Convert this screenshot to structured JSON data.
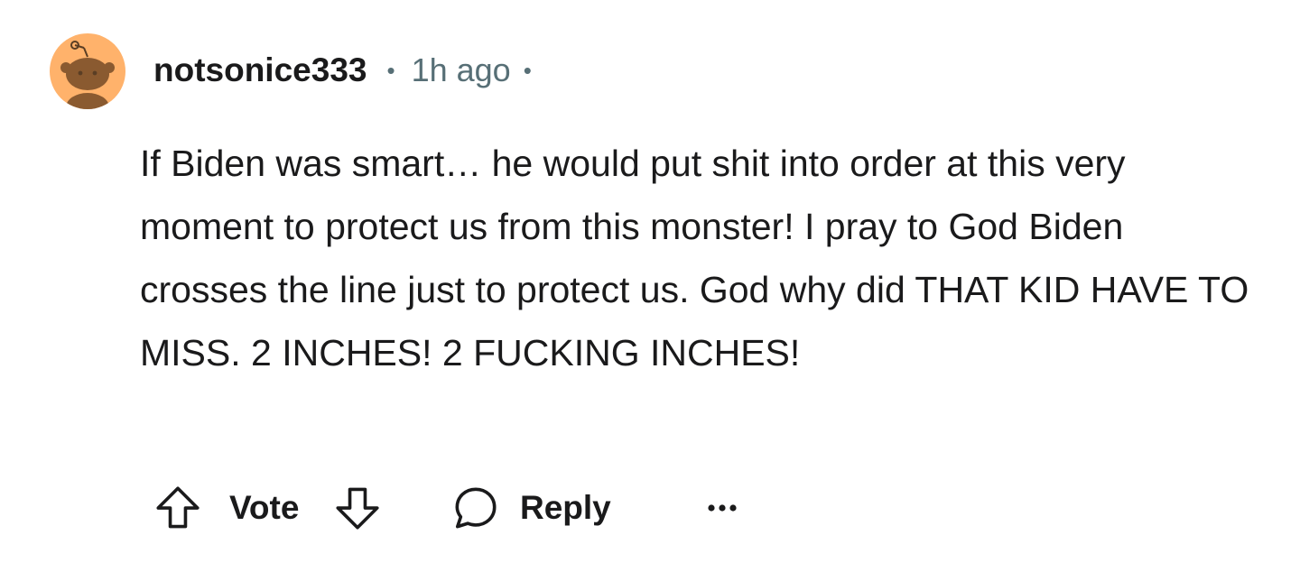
{
  "comment": {
    "author": "notsonice333",
    "separator": "•",
    "timestamp": "1h ago",
    "avatar_color": "#ffb26b",
    "avatar_icon": "snoo-avatar-icon",
    "body": "If Biden was smart… he would put shit into order at this very moment to protect us from this monster! I pray to God Biden crosses the line just to protect us. God why did THAT KID HAVE TO MISS. 2 INCHES! 2 FUCKING INCHES!"
  },
  "actions": {
    "upvote_icon": "arrow-up-icon",
    "vote_label": "Vote",
    "downvote_icon": "arrow-down-icon",
    "reply_icon": "speech-bubble-icon",
    "reply_label": "Reply",
    "more_icon": "ellipsis-icon"
  }
}
